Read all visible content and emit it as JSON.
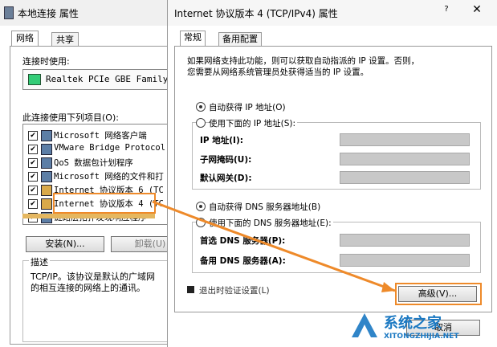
{
  "back_dialog": {
    "title": "本地连接 属性",
    "tabs": [
      "网络",
      "共享"
    ],
    "connect_using_label": "连接时使用:",
    "adapter": "Realtek PCIe GBE Family (",
    "items_label": "此连接使用下列项目(O):",
    "components": [
      {
        "label": "Microsoft 网络客户端",
        "checked": true
      },
      {
        "label": "VMware Bridge Protocol",
        "checked": true
      },
      {
        "label": "QoS 数据包计划程序",
        "checked": true
      },
      {
        "label": "Microsoft 网络的文件和打",
        "checked": true
      },
      {
        "label": "Internet 协议版本 6 (TC",
        "checked": true
      },
      {
        "label": "Internet 协议版本 4 (TC",
        "checked": true
      },
      {
        "label": "链路层拓扑发现响应程序",
        "checked": true
      }
    ],
    "install_button": "安装(N)...",
    "uninstall_button": "卸载(U)",
    "description_group": "描述",
    "description_text_1": "TCP/IP。该协议是默认的广域网",
    "description_text_2": "的相互连接的网络上的通讯。"
  },
  "front_dialog": {
    "title": "Internet 协议版本 4 (TCP/IPv4) 属性",
    "help": "?",
    "close": "✕",
    "tabs": [
      "常规",
      "备用配置"
    ],
    "intro_1": "如果网络支持此功能，则可以获取自动指派的 IP 设置。否则，",
    "intro_2": "您需要从网络系统管理员处获得适当的 IP 设置。",
    "auto_ip": "自动获得 IP 地址(O)",
    "manual_ip": "使用下面的 IP 地址(S):",
    "ip_label": "IP 地址(I):",
    "mask_label": "子网掩码(U):",
    "gateway_label": "默认网关(D):",
    "auto_dns": "自动获得 DNS 服务器地址(B)",
    "manual_dns": "使用下面的 DNS 服务器地址(E):",
    "preferred_dns": "首选 DNS 服务器(P):",
    "alternate_dns": "备用 DNS 服务器(A):",
    "validate_label": "退出时验证设置(L)",
    "advanced_button": "高级(V)...",
    "cancel_button": "取消"
  },
  "watermark": {
    "brand": "系统之家",
    "url": "XITONGZHIJIA.NET"
  },
  "colors": {
    "highlight": "#ee8a2a",
    "field_disabled": "#c8c8c8"
  }
}
